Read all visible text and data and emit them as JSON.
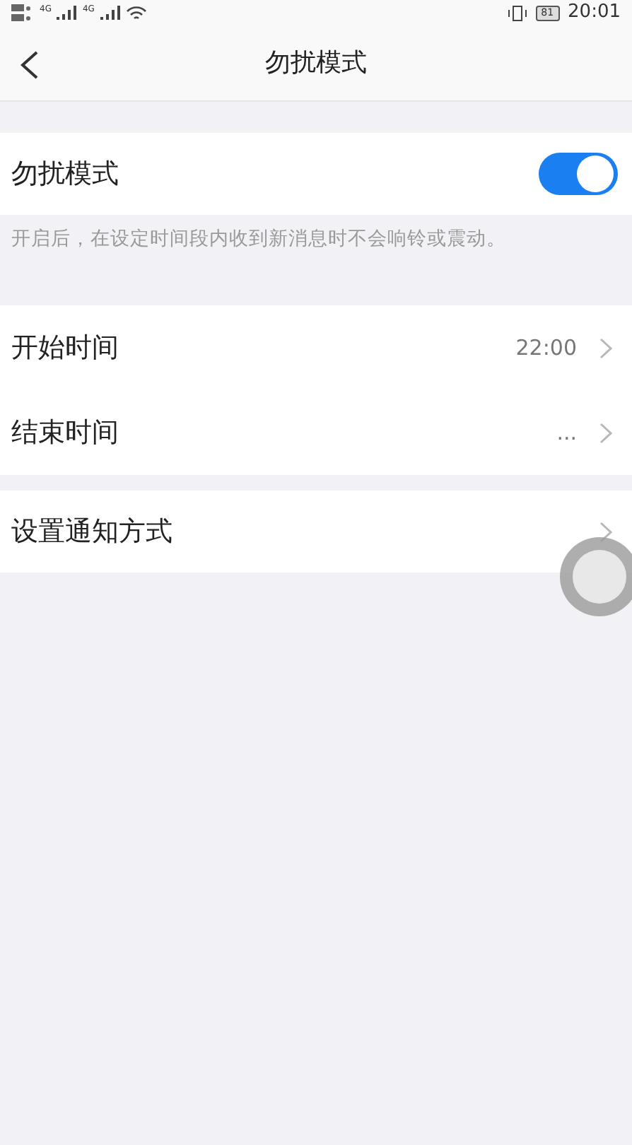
{
  "status_bar": {
    "network_1": "4G",
    "network_2": "4G",
    "battery": "81",
    "time": "20:01"
  },
  "nav": {
    "title": "勿扰模式"
  },
  "toggle": {
    "label": "勿扰模式",
    "on": true
  },
  "note": "开启后，在设定时间段内收到新消息时不会响铃或震动。",
  "time_rows": [
    {
      "label": "开始时间",
      "value": "22:00"
    },
    {
      "label": "结束时间",
      "value": "..."
    }
  ],
  "notify_row": {
    "label": "设置通知方式"
  }
}
